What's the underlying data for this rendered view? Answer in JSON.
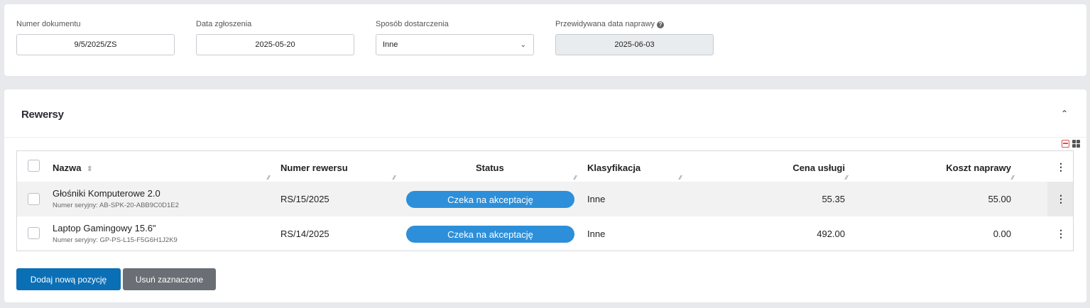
{
  "header_form": {
    "document_number": {
      "label": "Numer dokumentu",
      "value": "9/5/2025/ZS"
    },
    "report_date": {
      "label": "Data zgłoszenia",
      "value": "2025-05-20"
    },
    "delivery_method": {
      "label": "Sposób dostarczenia",
      "value": "Inne",
      "icon": "chevron-down-icon"
    },
    "expected_repair_date": {
      "label": "Przewidywana data naprawy",
      "value": "2025-06-03",
      "help_icon": "?"
    }
  },
  "section": {
    "title": "Rewersy"
  },
  "table": {
    "columns": [
      "Nazwa",
      "Numer rewersu",
      "Status",
      "Klasyfikacja",
      "Cena usługi",
      "Koszt naprawy"
    ],
    "rows": [
      {
        "name": "Głośniki Komputerowe 2.0",
        "serial": "Numer seryjny: AB-SPK-20-ABB9C0D1E2",
        "number": "RS/15/2025",
        "status": "Czeka na akceptację",
        "classification": "Inne",
        "service_price": "55.35",
        "repair_cost": "55.00"
      },
      {
        "name": "Laptop Gamingowy 15.6\"",
        "serial": "Numer seryjny: GP-PS-L15-F5G6H1J2K9",
        "number": "RS/14/2025",
        "status": "Czeka na akceptację",
        "classification": "Inne",
        "service_price": "492.00",
        "repair_cost": "0.00"
      }
    ]
  },
  "actions": {
    "add_label": "Dodaj nową pozycję",
    "delete_label": "Usuń zaznaczone"
  },
  "colors": {
    "primary": "#0b6fb6",
    "status_badge": "#2d8fd9",
    "secondary": "#6a6f75"
  }
}
